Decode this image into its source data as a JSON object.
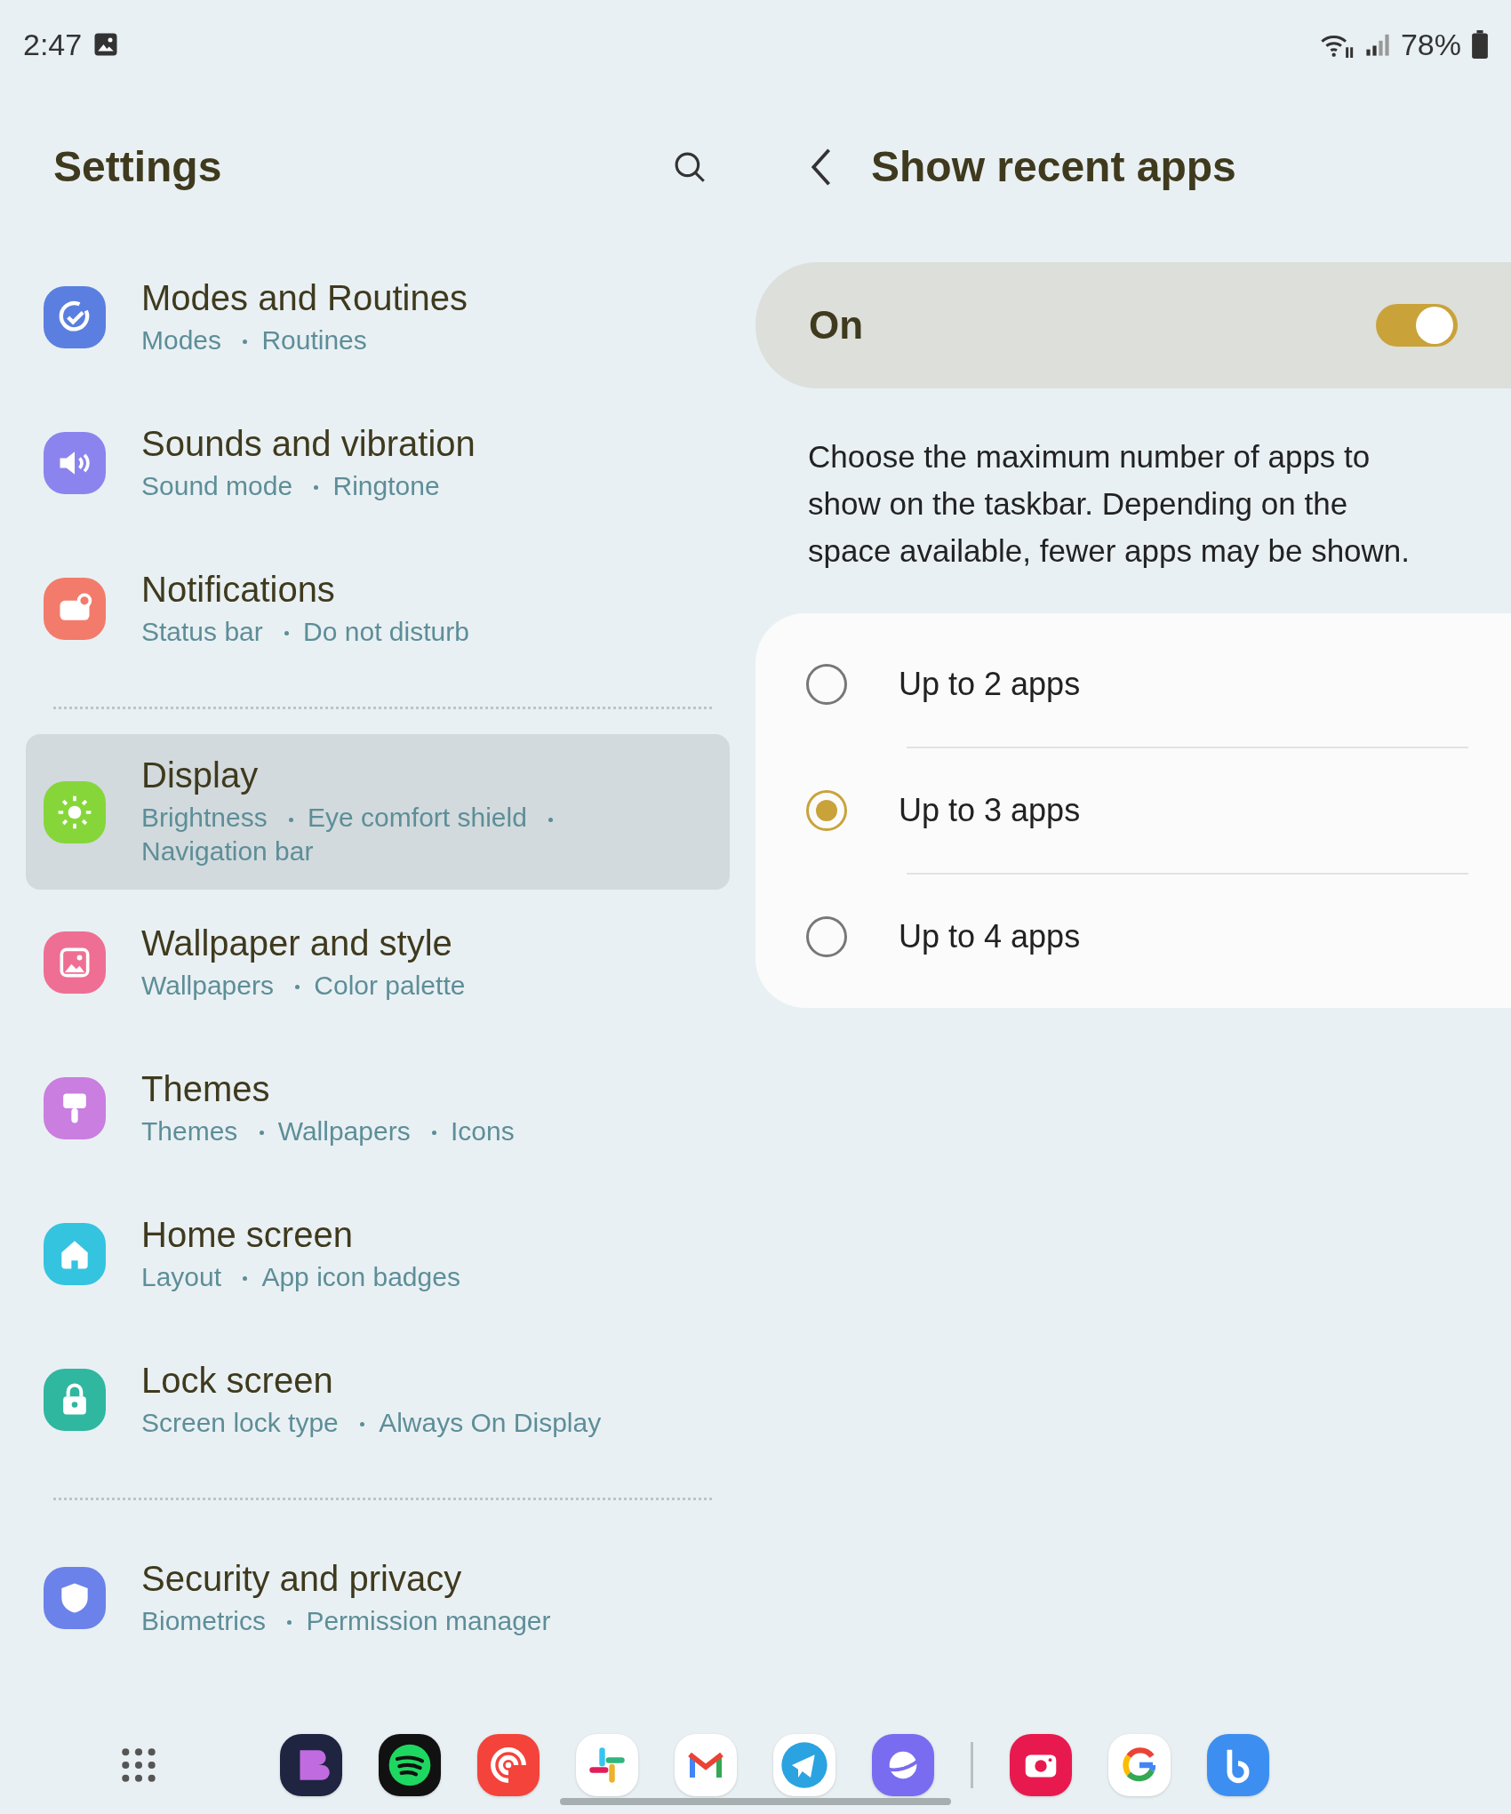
{
  "status_bar": {
    "time": "2:47",
    "battery": "78%"
  },
  "settings": {
    "title": "Settings",
    "groups": [
      [
        {
          "title": "Modes and Routines",
          "subtitle": [
            "Modes",
            "Routines"
          ],
          "color": "#5b7fe0",
          "selected": false
        },
        {
          "title": "Sounds and vibration",
          "subtitle": [
            "Sound mode",
            "Ringtone"
          ],
          "color": "#8b84ee",
          "selected": false
        },
        {
          "title": "Notifications",
          "subtitle": [
            "Status bar",
            "Do not disturb"
          ],
          "color": "#f37b6b",
          "selected": false
        }
      ],
      [
        {
          "title": "Display",
          "subtitle": [
            "Brightness",
            "Eye comfort shield",
            "Navigation bar"
          ],
          "color": "#86d63a",
          "selected": true
        },
        {
          "title": "Wallpaper and style",
          "subtitle": [
            "Wallpapers",
            "Color palette"
          ],
          "color": "#ee6f93",
          "selected": false
        },
        {
          "title": "Themes",
          "subtitle": [
            "Themes",
            "Wallpapers",
            "Icons"
          ],
          "color": "#c97ee0",
          "selected": false
        },
        {
          "title": "Home screen",
          "subtitle": [
            "Layout",
            "App icon badges"
          ],
          "color": "#35c4e0",
          "selected": false
        },
        {
          "title": "Lock screen",
          "subtitle": [
            "Screen lock type",
            "Always On Display"
          ],
          "color": "#2fb7a0",
          "selected": false
        }
      ],
      [
        {
          "title": "Security and privacy",
          "subtitle": [
            "Biometrics",
            "Permission manager"
          ],
          "color": "#6b82ea",
          "selected": false
        }
      ]
    ]
  },
  "detail": {
    "title": "Show recent apps",
    "toggle": {
      "label": "On",
      "on": true
    },
    "description": "Choose the maximum number of apps to show on the taskbar. Depending on the space available, fewer apps may be shown.",
    "options": [
      {
        "label": "Up to 2 apps",
        "selected": false
      },
      {
        "label": "Up to 3 apps",
        "selected": true
      },
      {
        "label": "Up to 4 apps",
        "selected": false
      }
    ]
  }
}
